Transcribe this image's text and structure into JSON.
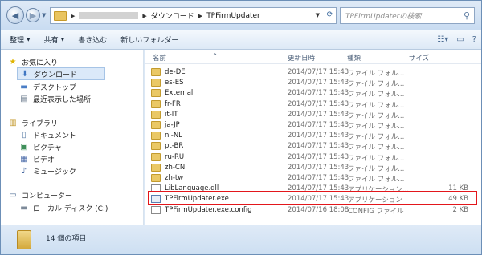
{
  "address": {
    "crumbs": [
      "ダウンロード",
      "TPFirmUpdater"
    ]
  },
  "search": {
    "placeholder": "TPFirmUpdaterの検索"
  },
  "toolbar": {
    "organize": "整理",
    "share": "共有",
    "burn": "書き込む",
    "new_folder": "新しいフォルダー"
  },
  "sidebar": {
    "favorites": "お気に入り",
    "downloads": "ダウンロード",
    "desktop": "デスクトップ",
    "recent": "最近表示した場所",
    "libraries": "ライブラリ",
    "documents": "ドキュメント",
    "pictures": "ピクチャ",
    "videos": "ビデオ",
    "music": "ミュージック",
    "computer": "コンピューター",
    "local_disk": "ローカル ディスク (C:)"
  },
  "columns": {
    "name": "名前",
    "date": "更新日時",
    "type": "種類",
    "size": "サイズ"
  },
  "files": [
    {
      "name": "de-DE",
      "date": "2014/07/17 15:43",
      "type": "ファイル フォル...",
      "size": "",
      "kind": "folder"
    },
    {
      "name": "es-ES",
      "date": "2014/07/17 15:43",
      "type": "ファイル フォル...",
      "size": "",
      "kind": "folder"
    },
    {
      "name": "External",
      "date": "2014/07/17 15:43",
      "type": "ファイル フォル...",
      "size": "",
      "kind": "folder"
    },
    {
      "name": "fr-FR",
      "date": "2014/07/17 15:43",
      "type": "ファイル フォル...",
      "size": "",
      "kind": "folder"
    },
    {
      "name": "it-IT",
      "date": "2014/07/17 15:43",
      "type": "ファイル フォル...",
      "size": "",
      "kind": "folder"
    },
    {
      "name": "ja-JP",
      "date": "2014/07/17 15:43",
      "type": "ファイル フォル...",
      "size": "",
      "kind": "folder"
    },
    {
      "name": "nl-NL",
      "date": "2014/07/17 15:43",
      "type": "ファイル フォル...",
      "size": "",
      "kind": "folder"
    },
    {
      "name": "pt-BR",
      "date": "2014/07/17 15:43",
      "type": "ファイル フォル...",
      "size": "",
      "kind": "folder"
    },
    {
      "name": "ru-RU",
      "date": "2014/07/17 15:43",
      "type": "ファイル フォル...",
      "size": "",
      "kind": "folder"
    },
    {
      "name": "zh-CN",
      "date": "2014/07/17 15:43",
      "type": "ファイル フォル...",
      "size": "",
      "kind": "folder"
    },
    {
      "name": "zh-tw",
      "date": "2014/07/17 15:43",
      "type": "ファイル フォル...",
      "size": "",
      "kind": "folder"
    },
    {
      "name": "LibLanguage.dll",
      "date": "2014/07/17 15:43",
      "type": "アプリケーション...",
      "size": "11 KB",
      "kind": "file"
    },
    {
      "name": "TPFirmUpdater.exe",
      "date": "2014/07/17 15:43",
      "type": "アプリケーション",
      "size": "49 KB",
      "kind": "exe"
    },
    {
      "name": "TPFirmUpdater.exe.config",
      "date": "2014/07/16 18:08",
      "type": "CONFIG ファイル",
      "size": "2 KB",
      "kind": "file"
    }
  ],
  "status": {
    "count_text": "14 個の項目"
  },
  "colors": {
    "highlight": "#e3161b",
    "folder": "#eac865"
  }
}
